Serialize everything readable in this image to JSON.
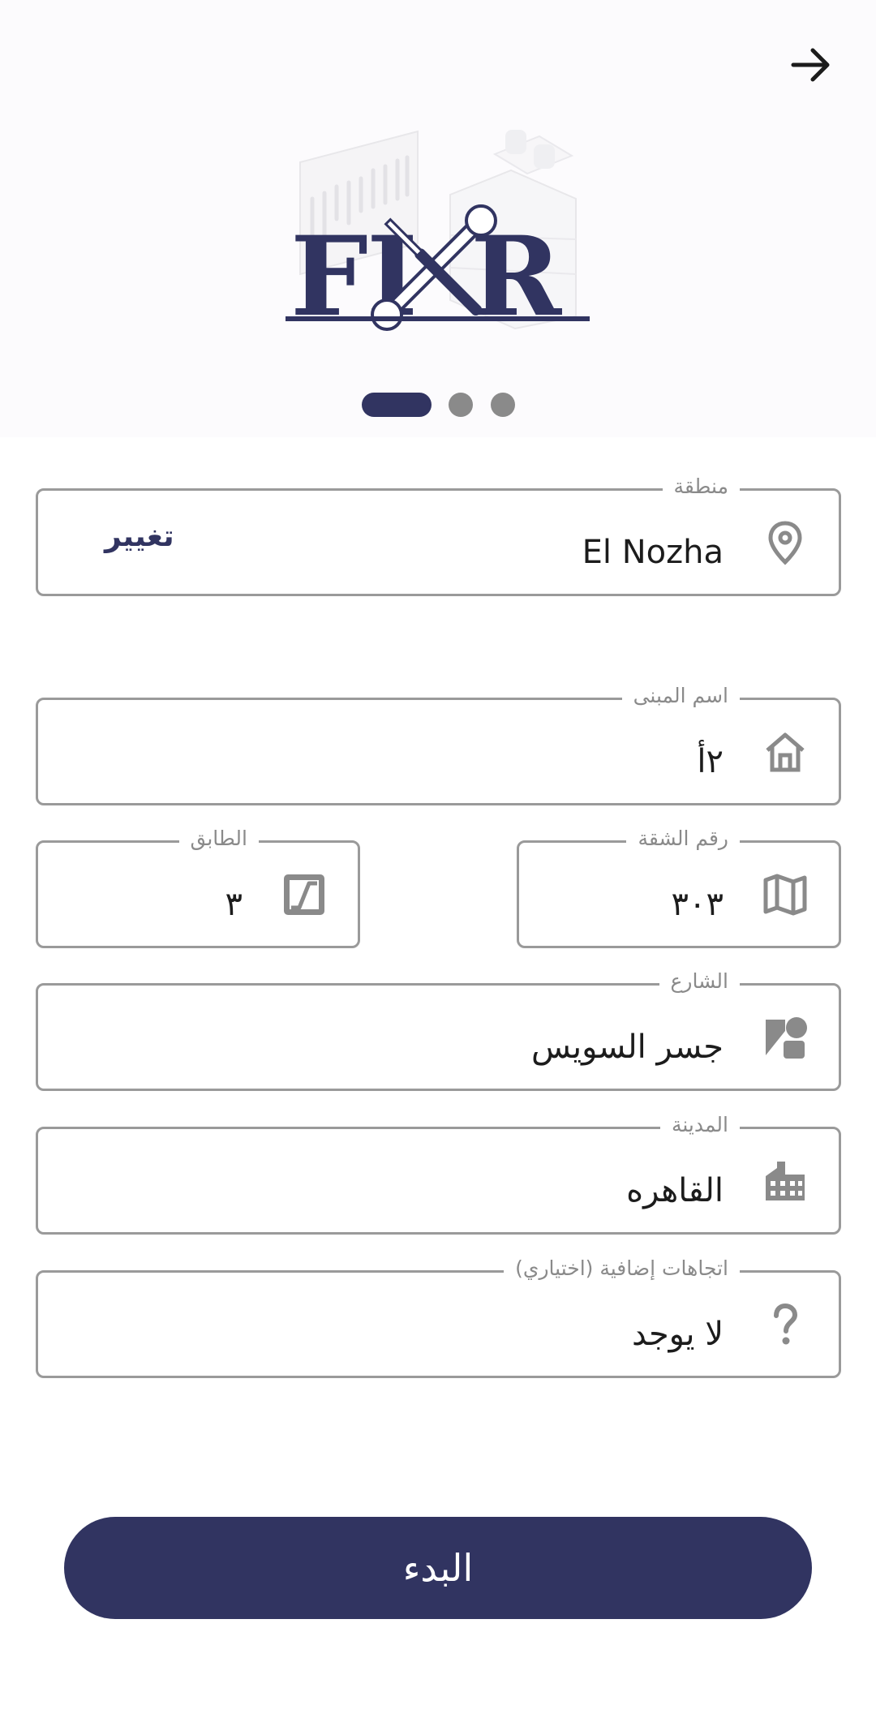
{
  "header": {
    "back_icon": "arrow-right-icon",
    "logo_text": "FIXR",
    "pager": {
      "total": 3,
      "active": 1
    }
  },
  "form": {
    "area": {
      "label": "منطقة",
      "value": "El Nozha",
      "action": "تغيير",
      "icon": "location-pin-icon"
    },
    "building": {
      "label": "اسم المبنى",
      "value": "٢أ",
      "icon": "home-icon"
    },
    "apartment": {
      "label": "رقم الشقة",
      "value": "٣٠٣",
      "icon": "map-icon"
    },
    "floor": {
      "label": "الطابق",
      "value": "٣",
      "icon": "stairs-icon"
    },
    "street": {
      "label": "الشارع",
      "value": "جسر السويس",
      "icon": "street-shapes-icon"
    },
    "city": {
      "label": "المدينة",
      "value": "القاهره",
      "icon": "city-buildings-icon"
    },
    "directions": {
      "label": "اتجاهات إضافية (اختياري)",
      "value": "لا يوجد",
      "icon": "question-mark-icon"
    }
  },
  "start_button": {
    "label": "البدء"
  },
  "colors": {
    "primary": "#313461",
    "border": "#9a9a9a",
    "label": "#8a8a8a",
    "header_bg": "#fcfbfd",
    "dot_inactive": "#8a8a8a"
  }
}
